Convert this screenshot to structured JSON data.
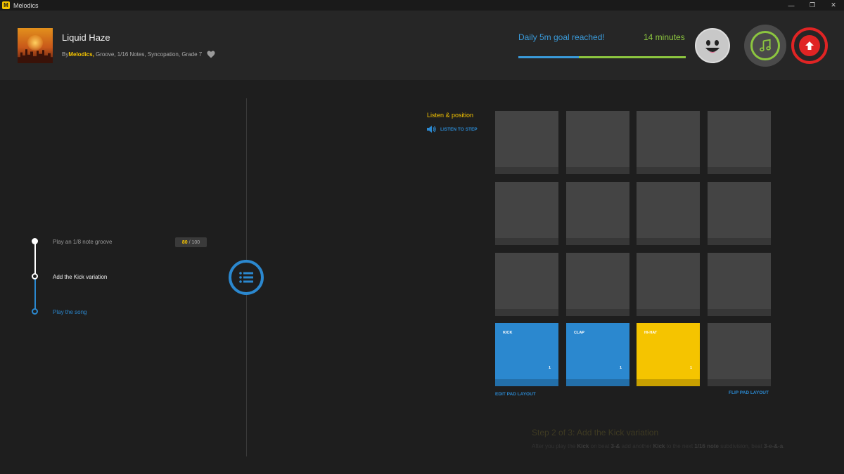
{
  "window": {
    "app_icon_letter": "M",
    "title": "Melodics",
    "controls": {
      "minimize": "—",
      "restore": "❐",
      "close": "✕"
    }
  },
  "song": {
    "title": "Liquid Haze",
    "by": "By ",
    "author": "Melodics,",
    "tags": "Groove, 1/16 Notes, Syncopation, Grade 7"
  },
  "goal": {
    "text": "Daily 5m goal reached!",
    "minutes": "14 minutes",
    "progress_fraction": 0.36
  },
  "steps": [
    {
      "label": "Play an 1/8 note groove",
      "score": "80",
      "score_total": " / 100"
    },
    {
      "label": "Add the Kick variation"
    },
    {
      "label": "Play the song"
    }
  ],
  "listen": {
    "title": "Listen & position",
    "button": "LISTEN TO STEP"
  },
  "pads": {
    "kick": {
      "label": "KICK",
      "num": "1"
    },
    "clap": {
      "label": "CLAP",
      "num": "1"
    },
    "hihat": {
      "label": "HI-HAT",
      "num": "1"
    },
    "edit_layout": "EDIT PAD LAYOUT",
    "flip_layout": "FLIP PAD LAYOUT"
  },
  "instruction": {
    "title": "Step 2 of 3: Add the Kick variation",
    "p1": "After you play the ",
    "b1": "Kick",
    "p2": " on beat ",
    "b2": "3-&",
    "p3": " add another ",
    "b3": "Kick",
    "p4": " to the next ",
    "b4": "1/16 note",
    "p5": " subdivision, beat ",
    "b5": "3-e-&-a",
    "p6": "."
  },
  "colors": {
    "blue": "#2b88cf",
    "green": "#8cc63f",
    "yellow": "#f5c400",
    "red": "#e02424"
  }
}
